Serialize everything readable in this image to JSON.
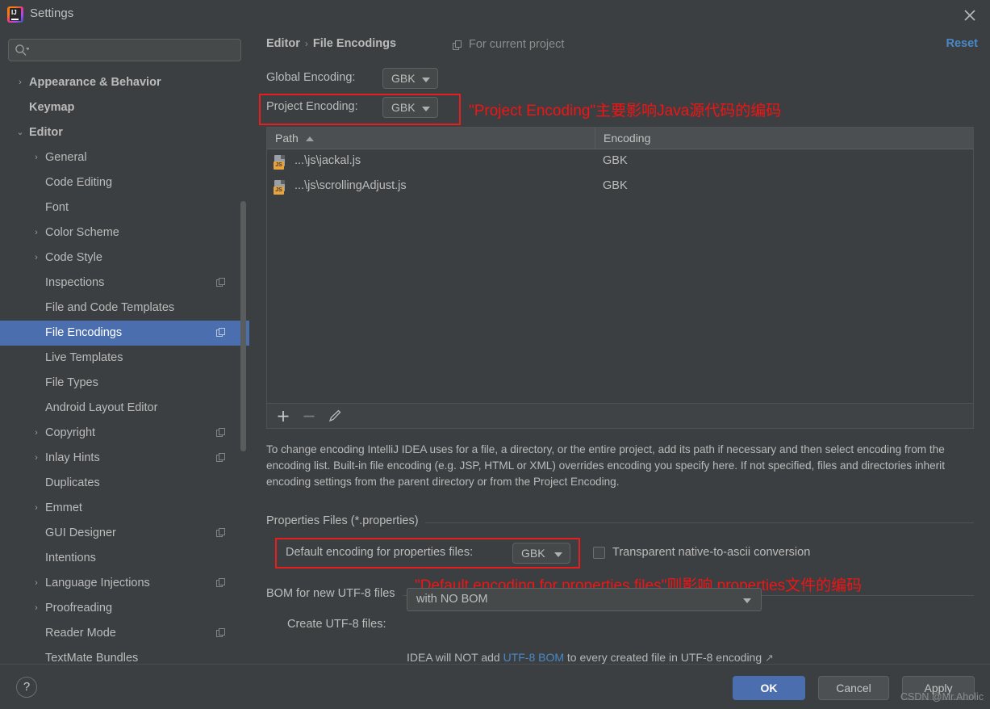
{
  "window": {
    "title": "Settings",
    "logo_text": "IJ",
    "close_icon": "close-icon"
  },
  "sidebar": {
    "search_placeholder": "",
    "items": [
      {
        "label": "Appearance & Behavior",
        "depth": 0,
        "arrow": "›",
        "bold": true,
        "badge": false,
        "selected": false
      },
      {
        "label": "Keymap",
        "depth": 0,
        "arrow": "",
        "bold": true,
        "badge": false,
        "selected": false
      },
      {
        "label": "Editor",
        "depth": 0,
        "arrow": "⌄",
        "bold": true,
        "badge": false,
        "selected": false
      },
      {
        "label": "General",
        "depth": 1,
        "arrow": "›",
        "bold": false,
        "badge": false,
        "selected": false
      },
      {
        "label": "Code Editing",
        "depth": 1,
        "arrow": "",
        "bold": false,
        "badge": false,
        "selected": false
      },
      {
        "label": "Font",
        "depth": 1,
        "arrow": "",
        "bold": false,
        "badge": false,
        "selected": false
      },
      {
        "label": "Color Scheme",
        "depth": 1,
        "arrow": "›",
        "bold": false,
        "badge": false,
        "selected": false
      },
      {
        "label": "Code Style",
        "depth": 1,
        "arrow": "›",
        "bold": false,
        "badge": false,
        "selected": false
      },
      {
        "label": "Inspections",
        "depth": 1,
        "arrow": "",
        "bold": false,
        "badge": true,
        "selected": false
      },
      {
        "label": "File and Code Templates",
        "depth": 1,
        "arrow": "",
        "bold": false,
        "badge": false,
        "selected": false
      },
      {
        "label": "File Encodings",
        "depth": 1,
        "arrow": "",
        "bold": false,
        "badge": true,
        "selected": true
      },
      {
        "label": "Live Templates",
        "depth": 1,
        "arrow": "",
        "bold": false,
        "badge": false,
        "selected": false
      },
      {
        "label": "File Types",
        "depth": 1,
        "arrow": "",
        "bold": false,
        "badge": false,
        "selected": false
      },
      {
        "label": "Android Layout Editor",
        "depth": 1,
        "arrow": "",
        "bold": false,
        "badge": false,
        "selected": false
      },
      {
        "label": "Copyright",
        "depth": 1,
        "arrow": "›",
        "bold": false,
        "badge": true,
        "selected": false
      },
      {
        "label": "Inlay Hints",
        "depth": 1,
        "arrow": "›",
        "bold": false,
        "badge": true,
        "selected": false
      },
      {
        "label": "Duplicates",
        "depth": 1,
        "arrow": "",
        "bold": false,
        "badge": false,
        "selected": false
      },
      {
        "label": "Emmet",
        "depth": 1,
        "arrow": "›",
        "bold": false,
        "badge": false,
        "selected": false
      },
      {
        "label": "GUI Designer",
        "depth": 1,
        "arrow": "",
        "bold": false,
        "badge": true,
        "selected": false
      },
      {
        "label": "Intentions",
        "depth": 1,
        "arrow": "",
        "bold": false,
        "badge": false,
        "selected": false
      },
      {
        "label": "Language Injections",
        "depth": 1,
        "arrow": "›",
        "bold": false,
        "badge": true,
        "selected": false
      },
      {
        "label": "Proofreading",
        "depth": 1,
        "arrow": "›",
        "bold": false,
        "badge": false,
        "selected": false
      },
      {
        "label": "Reader Mode",
        "depth": 1,
        "arrow": "",
        "bold": false,
        "badge": true,
        "selected": false
      },
      {
        "label": "TextMate Bundles",
        "depth": 1,
        "arrow": "",
        "bold": false,
        "badge": false,
        "selected": false
      }
    ]
  },
  "header": {
    "breadcrumb_root": "Editor",
    "breadcrumb_sep": "›",
    "breadcrumb_leaf": "File Encodings",
    "for_current_project": "For current project",
    "reset_label": "Reset"
  },
  "encodings": {
    "global_label": "Global Encoding:",
    "global_value": "GBK",
    "project_label": "Project Encoding:",
    "project_value": "GBK"
  },
  "table": {
    "columns": [
      "Path",
      "Encoding"
    ],
    "sort_column": "Path",
    "sort_direction": "ascending",
    "rows": [
      {
        "path": "...\\js\\jackal.js",
        "encoding": "GBK",
        "icon": "js-file-icon",
        "badge": "JS"
      },
      {
        "path": "...\\js\\scrollingAdjust.js",
        "encoding": "GBK",
        "icon": "js-file-icon",
        "badge": "JS"
      }
    ],
    "toolbar": {
      "add": "+",
      "remove": "−",
      "edit": "pencil-icon"
    }
  },
  "description": "To change encoding IntelliJ IDEA uses for a file, a directory, or the entire project, add its path if necessary and then select encoding from the encoding list. Built-in file encoding (e.g. JSP, HTML or XML) overrides encoding you specify here. If not specified, files and directories inherit encoding settings from the parent directory or from the Project Encoding.",
  "properties_section": {
    "title": "Properties Files (*.properties)",
    "default_encoding_label": "Default encoding for properties files:",
    "default_encoding_value": "GBK",
    "transparent_label": "Transparent native-to-ascii conversion",
    "transparent_checked": false
  },
  "bom_section": {
    "title": "BOM for new UTF-8 files",
    "create_label": "Create UTF-8 files:",
    "create_value": "with NO BOM",
    "hint_prefix": "IDEA will NOT add ",
    "hint_link": "UTF-8 BOM",
    "hint_suffix": " to every created file in UTF-8 encoding",
    "hint_external_icon": "↗"
  },
  "annotations": {
    "color": "#f01414",
    "note1": "\"Project Encoding\"主要影响Java源代码的编码",
    "note2": "\"Default encoding for properties files\"则影响.properties文件的编码"
  },
  "footer": {
    "help_label": "?",
    "ok_label": "OK",
    "cancel_label": "Cancel",
    "apply_label": "Apply",
    "watermark": "CSDN @Mr.Aholic"
  },
  "colors": {
    "background": "#3c3f41",
    "selection": "#4b6eaf",
    "link": "#4a88c7",
    "annotation_red": "#f01414",
    "js_badge": "#e8a33d"
  }
}
